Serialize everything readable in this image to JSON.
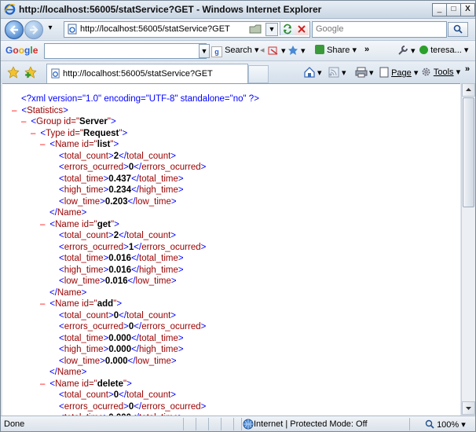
{
  "window": {
    "title": "http://localhost:56005/statService?GET - Windows Internet Explorer",
    "minimize": "_",
    "maximize": "□",
    "close": "X"
  },
  "address_bar": {
    "url": "http://localhost:56005/statService?GET",
    "search_placeholder": "Google"
  },
  "google_toolbar": {
    "logo": "Google",
    "search_label": "Search",
    "share_label": "Share",
    "more": "»",
    "user": "teresa..."
  },
  "tab": {
    "title": "http://localhost:56005/statService?GET"
  },
  "command_bar": {
    "page_label": "Page",
    "tools_label": "Tools",
    "more": "»"
  },
  "xml": {
    "declaration": "<?xml version=\"1.0\" encoding=\"UTF-8\" standalone=\"no\" ?>",
    "root": "Statistics",
    "group_id": "Server",
    "type_id": "Request",
    "names": [
      {
        "id": "list",
        "total_count": "2",
        "errors_ocurred": "0",
        "total_time": "0.437",
        "high_time": "0.234",
        "low_time": "0.203"
      },
      {
        "id": "get",
        "total_count": "2",
        "errors_ocurred": "1",
        "total_time": "0.016",
        "high_time": "0.016",
        "low_time": "0.016"
      },
      {
        "id": "add",
        "total_count": "0",
        "errors_ocurred": "0",
        "total_time": "0.000",
        "high_time": "0.000",
        "low_time": "0.000"
      },
      {
        "id": "delete",
        "total_count": "0",
        "errors_ocurred": "0",
        "total_time": "0.000"
      }
    ]
  },
  "status_bar": {
    "status": "Done",
    "zone": "Internet | Protected Mode: Off",
    "zoom": "100%"
  }
}
